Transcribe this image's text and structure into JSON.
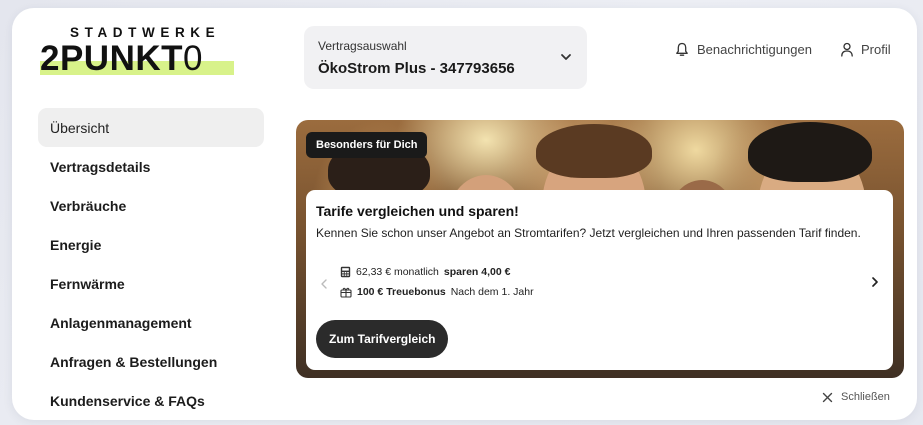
{
  "logo": {
    "top_text": "STADTWERKE",
    "main_text_a": "2PUNKT",
    "main_text_b": "0"
  },
  "contract": {
    "label": "Vertragsauswahl",
    "value": "ÖkoStrom Plus - 347793656",
    "icon": "chevron-down-icon"
  },
  "header": {
    "notifications_label": "Benachrichtigungen",
    "notifications_icon": "bell-icon",
    "profile_label": "Profil",
    "profile_icon": "user-icon"
  },
  "sidebar": {
    "items": [
      {
        "label": "Übersicht",
        "active": true
      },
      {
        "label": "Vertragsdetails",
        "active": false
      },
      {
        "label": "Verbräuche",
        "active": false
      },
      {
        "label": "Energie",
        "active": false
      },
      {
        "label": "Fernwärme",
        "active": false
      },
      {
        "label": "Anlagenmanagement",
        "active": false
      },
      {
        "label": "Anfragen & Bestellungen",
        "active": false
      },
      {
        "label": "Kundenservice & FAQs",
        "active": false
      }
    ]
  },
  "banner": {
    "badge": "Besonders für Dich",
    "title": "Tarife vergleichen und sparen!",
    "description": "Kennen Sie schon unser Angebot an Stromtarifen? Jetzt vergleichen und Ihren passenden Tarif finden.",
    "line1_a": "62,33 € monatlich",
    "line1_b": "sparen 4,00 €",
    "line1_icon": "calculator-icon",
    "line2_a": "100 € Treuebonus",
    "line2_b": "Nach dem 1. Jahr",
    "line2_icon": "gift-icon",
    "cta_label": "Zum Tarifvergleich",
    "prev_icon": "chevron-left-icon",
    "next_icon": "chevron-right-icon"
  },
  "close": {
    "label": "Schließen",
    "icon": "close-icon"
  },
  "colors": {
    "accent_highlight": "#d8f28a",
    "dark": "#1a1a1a",
    "active_nav_bg": "#efefef"
  }
}
